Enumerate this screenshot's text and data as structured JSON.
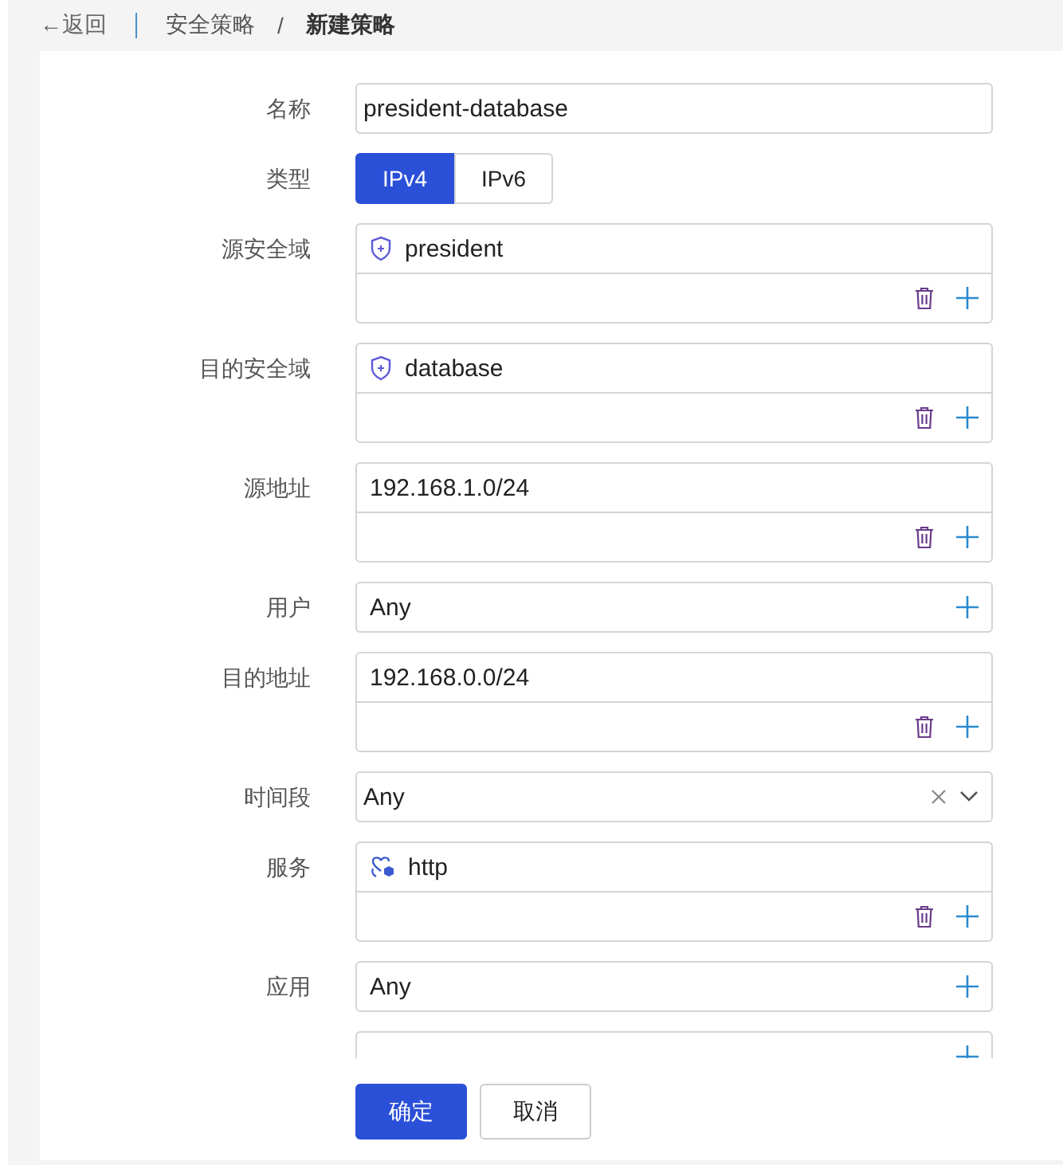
{
  "breadcrumb": {
    "back": "←返回",
    "items": [
      "安全策略",
      "新建策略"
    ],
    "separator": "/"
  },
  "form": [
    {
      "kind": "text",
      "label": "名称",
      "value": "president-database"
    },
    {
      "kind": "segmented",
      "label": "类型",
      "options": [
        {
          "label": "IPv4",
          "selected": true
        },
        {
          "label": "IPv6",
          "selected": false
        }
      ]
    },
    {
      "kind": "multi",
      "label": "源安全域",
      "items": [
        {
          "kind": "zone",
          "text": "president"
        }
      ]
    },
    {
      "kind": "multi",
      "label": "目的安全域",
      "items": [
        {
          "kind": "zone",
          "text": "database"
        }
      ]
    },
    {
      "kind": "multi",
      "label": "源地址",
      "items": [
        {
          "kind": "plain",
          "text": "192.168.1.0/24"
        }
      ]
    },
    {
      "kind": "add",
      "label": "用户",
      "value": "Any"
    },
    {
      "kind": "multi",
      "label": "目的地址",
      "items": [
        {
          "kind": "plain",
          "text": "192.168.0.0/24"
        }
      ]
    },
    {
      "kind": "select",
      "label": "时间段",
      "value": "Any"
    },
    {
      "kind": "multi",
      "label": "服务",
      "items": [
        {
          "kind": "service",
          "text": "http"
        }
      ]
    },
    {
      "kind": "add",
      "label": "应用",
      "value": "Any"
    },
    {
      "kind": "add"
    }
  ],
  "buttons": [
    {
      "label": "确定",
      "kind": "primary"
    },
    {
      "label": "取消",
      "kind": "default"
    }
  ]
}
